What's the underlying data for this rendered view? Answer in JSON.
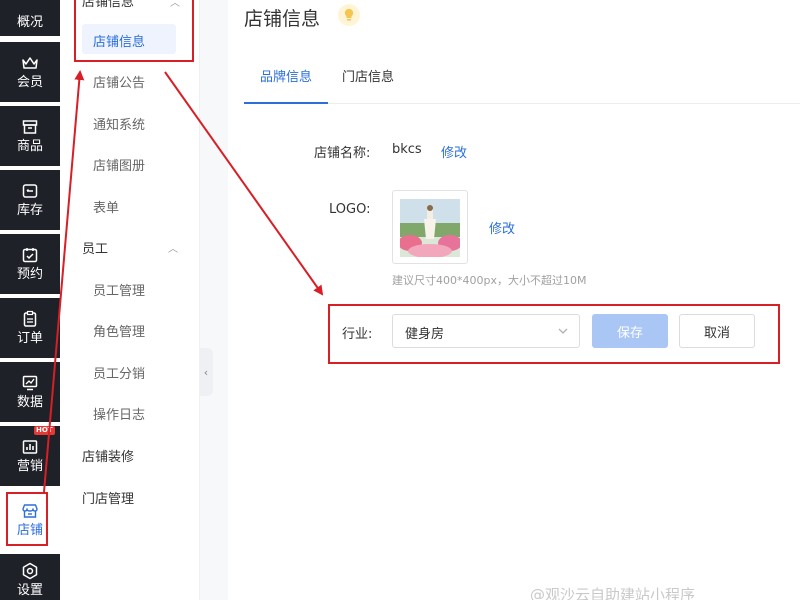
{
  "nav": {
    "items": [
      {
        "label": "概况",
        "icon": "grid-icon"
      },
      {
        "label": "会员",
        "icon": "crown-icon"
      },
      {
        "label": "商品",
        "icon": "box-icon"
      },
      {
        "label": "库存",
        "icon": "inventory-icon"
      },
      {
        "label": "预约",
        "icon": "calendar-check-icon"
      },
      {
        "label": "订单",
        "icon": "clipboard-icon"
      },
      {
        "label": "数据",
        "icon": "chart-monitor-icon"
      },
      {
        "label": "营销",
        "icon": "bar-chart-icon",
        "badge": "HOT"
      },
      {
        "label": "店铺",
        "icon": "store-icon",
        "active": true
      },
      {
        "label": "设置",
        "icon": "gear-icon"
      }
    ]
  },
  "submenu": {
    "group_shop": "店铺信息",
    "items_shop": [
      "店铺信息",
      "店铺公告",
      "通知系统",
      "店铺图册",
      "表单"
    ],
    "group_staff": "员工",
    "items_staff": [
      "员工管理",
      "角色管理",
      "员工分销",
      "操作日志"
    ],
    "group_decor": "店铺装修",
    "group_store": "门店管理"
  },
  "page": {
    "title": "店铺信息",
    "tabs": [
      "品牌信息",
      "门店信息"
    ],
    "active_tab": 0
  },
  "form": {
    "name_label": "店铺名称:",
    "name_value": "bkcs",
    "edit_label": "修改",
    "logo_label": "LOGO:",
    "logo_edit_label": "修改",
    "logo_hint": "建议尺寸400*400px，大小不超过10M",
    "industry_label": "行业:",
    "industry_value": "健身房",
    "save_label": "保存",
    "cancel_label": "取消"
  },
  "watermark": "@观沙云自助建站小程序",
  "colors": {
    "accent": "#2c6fd8",
    "nav_bg": "#1f2129",
    "annotation": "#d71f26",
    "save_disabled": "#a9c6f5"
  }
}
